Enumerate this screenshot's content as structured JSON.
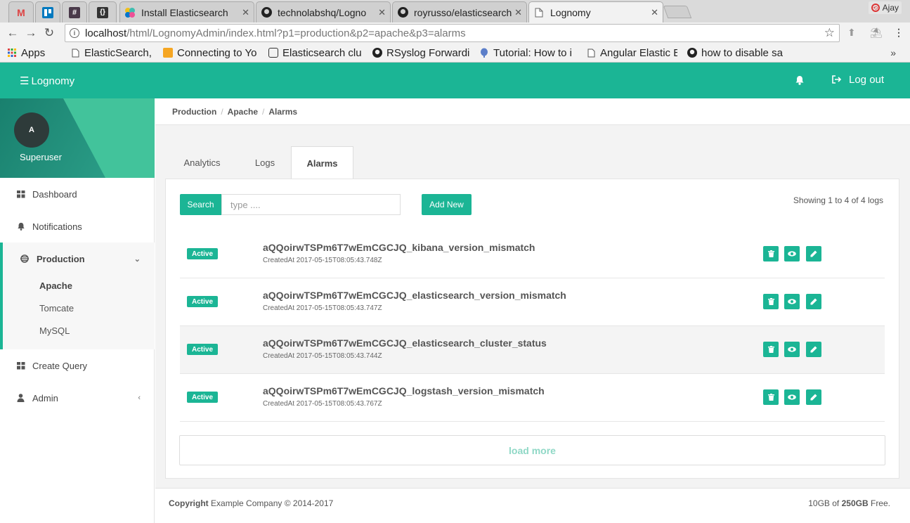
{
  "browser": {
    "tabs": [
      {
        "icon": "gmail-icon",
        "title": ""
      },
      {
        "icon": "trello-icon",
        "title": ""
      },
      {
        "icon": "slack-icon",
        "title": ""
      },
      {
        "icon": "json-icon",
        "title": ""
      },
      {
        "icon": "elastic-icon",
        "title": "Install Elasticsearch"
      },
      {
        "icon": "github-icon",
        "title": "technolabshq/Logno"
      },
      {
        "icon": "github-icon",
        "title": "royrusso/elasticsearch"
      },
      {
        "icon": "document-icon",
        "title": "Lognomy"
      }
    ],
    "profile_name": "Ajay",
    "url_host": "localhost",
    "url_path": "/html/LognomyAdmin/index.html?p1=production&p2=apache&p3=alarms",
    "bookmarks": [
      {
        "icon": "apps-grid-icon",
        "label": "Apps"
      },
      {
        "icon": "page-icon",
        "label": "ElasticSearch, ma"
      },
      {
        "icon": "box-icon",
        "label": "Connecting to Yo"
      },
      {
        "icon": "discourse-icon",
        "label": "Elasticsearch clu"
      },
      {
        "icon": "github-icon",
        "label": "RSyslog Forwardi"
      },
      {
        "icon": "tutorial-icon",
        "label": "Tutorial: How to i"
      },
      {
        "icon": "page-icon",
        "label": "Angular Elastic B"
      },
      {
        "icon": "github-icon",
        "label": "how to disable sa"
      }
    ],
    "bookmarks_more": "»"
  },
  "app": {
    "brand": "Lognomy",
    "logout_label": "Log out",
    "accent_color": "#1bb595"
  },
  "sidebar": {
    "avatar_initial": "A",
    "user_name": "Superuser",
    "items": {
      "dashboard": "Dashboard",
      "notifications": "Notifications",
      "production": "Production",
      "create_query": "Create Query",
      "admin": "Admin"
    },
    "production_children": [
      "Apache",
      "Tomcate",
      "MySQL"
    ]
  },
  "breadcrumb": [
    "Production",
    "Apache",
    "Alarms"
  ],
  "tabs": [
    "Analytics",
    "Logs",
    "Alarms"
  ],
  "toolbar": {
    "search_label": "Search",
    "search_placeholder": "type ....",
    "add_new_label": "Add New",
    "showing_text": "Showing 1 to 4 of 4 logs"
  },
  "alarms": [
    {
      "status": "Active",
      "name": "aQQoirwTSPm6T7wEmCGCJQ_kibana_version_mismatch",
      "created": "CreatedAt 2017-05-15T08:05:43.748Z"
    },
    {
      "status": "Active",
      "name": "aQQoirwTSPm6T7wEmCGCJQ_elasticsearch_version_mismatch",
      "created": "CreatedAt 2017-05-15T08:05:43.747Z"
    },
    {
      "status": "Active",
      "name": "aQQoirwTSPm6T7wEmCGCJQ_elasticsearch_cluster_status",
      "created": "CreatedAt 2017-05-15T08:05:43.744Z"
    },
    {
      "status": "Active",
      "name": "aQQoirwTSPm6T7wEmCGCJQ_logstash_version_mismatch",
      "created": "CreatedAt 2017-05-15T08:05:43.767Z"
    }
  ],
  "load_more_label": "load more",
  "footer": {
    "copyright_bold": "Copyright",
    "copyright_rest": "Example Company © 2014-2017",
    "storage_used": "10GB of",
    "storage_total": "250GB",
    "storage_suffix": "Free."
  }
}
